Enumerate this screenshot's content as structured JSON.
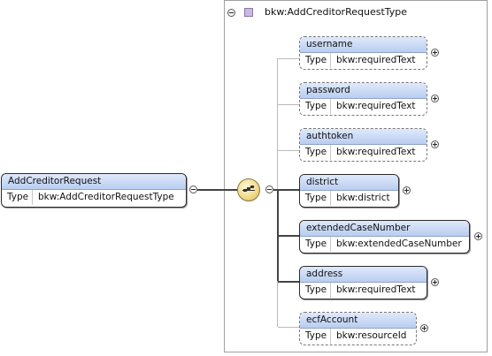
{
  "root": {
    "name": "AddCreditorRequest",
    "type_key": "Type",
    "type_value": "bkw:AddCreditorRequestType"
  },
  "complex_type": {
    "title": "bkw:AddCreditorRequestType"
  },
  "children": [
    {
      "name": "username",
      "type_key": "Type",
      "type_value": "bkw:requiredText",
      "optional": true
    },
    {
      "name": "password",
      "type_key": "Type",
      "type_value": "bkw:requiredText",
      "optional": true
    },
    {
      "name": "authtoken",
      "type_key": "Type",
      "type_value": "bkw:requiredText",
      "optional": true
    },
    {
      "name": "district",
      "type_key": "Type",
      "type_value": "bkw:district",
      "optional": false
    },
    {
      "name": "extendedCaseNumber",
      "type_key": "Type",
      "type_value": "bkw:extendedCaseNumber",
      "optional": false
    },
    {
      "name": "address",
      "type_key": "Type",
      "type_value": "bkw:requiredText",
      "optional": false
    },
    {
      "name": "ecfAccount",
      "type_key": "Type",
      "type_value": "bkw:resourceId",
      "optional": true
    }
  ]
}
